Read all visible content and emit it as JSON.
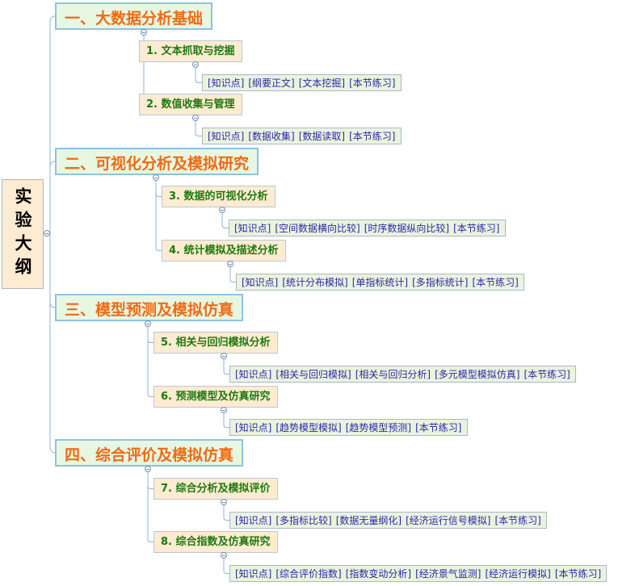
{
  "root": {
    "title": "实验大纲"
  },
  "chapters": [
    {
      "title": "一、大数据分析基础",
      "sections": [
        {
          "title": "1. 文本抓取与挖掘",
          "items": [
            "[知识点]",
            "[纲要正文]",
            "[文本挖掘]",
            "[本节练习]"
          ]
        },
        {
          "title": "2. 数值收集与管理",
          "items": [
            "[知识点]",
            "[数据收集]",
            "[数据读取]",
            "[本节练习]"
          ]
        }
      ]
    },
    {
      "title": "二、可视化分析及模拟研究",
      "sections": [
        {
          "title": "3. 数据的可视化分析",
          "items": [
            "[知识点]",
            "[空间数据横向比较]",
            "[时序数据纵向比较]",
            "[本节练习]"
          ]
        },
        {
          "title": "4. 统计模拟及描述分析",
          "items": [
            "[知识点]",
            "[统计分布模拟]",
            "[单指标统计]",
            "[多指标统计]",
            "[本节练习]"
          ]
        }
      ]
    },
    {
      "title": "三、模型预测及模拟仿真",
      "sections": [
        {
          "title": "5. 相关与回归模拟分析",
          "items": [
            "[知识点]",
            "[相关与回归模拟]",
            "[相关与回归分析]",
            "[多元模型模拟仿真]",
            "[本节练习]"
          ]
        },
        {
          "title": "6. 预测模型及仿真研究",
          "items": [
            "[知识点]",
            "[趋势模型模拟]",
            "[趋势模型预测]",
            "[本节练习]"
          ]
        }
      ]
    },
    {
      "title": "四、综合评价及模拟仿真",
      "sections": [
        {
          "title": "7. 综合分析及模拟评价",
          "items": [
            "[知识点]",
            "[多指标比较]",
            "[数据无量纲化]",
            "[经济运行信号模拟]",
            "[本节练习]"
          ]
        },
        {
          "title": "8. 综合指数及仿真研究",
          "items": [
            "[知识点]",
            "[综合评价指数]",
            "[指数变动分析]",
            "[经济景气监测]",
            "[经济运行模拟]",
            "[本节练习]"
          ]
        }
      ]
    }
  ],
  "colors": {
    "chapter_text": "#ef6b15",
    "section_text": "#1e7a10",
    "leaf_text": "#2a2aa8",
    "connector": "#8eb4d9"
  }
}
